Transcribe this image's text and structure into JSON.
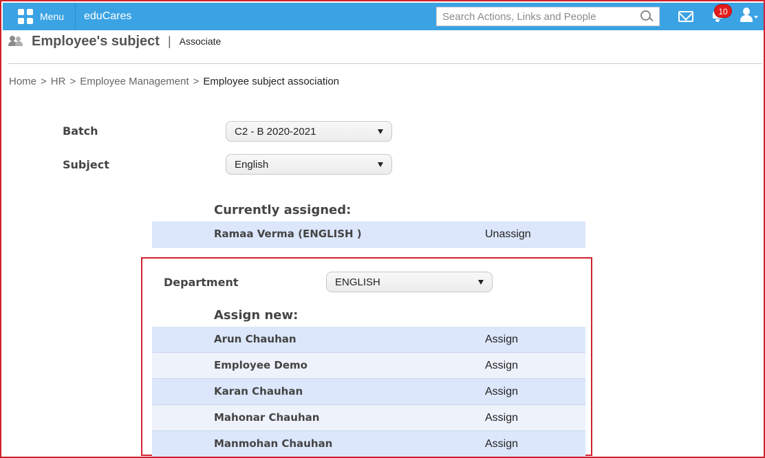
{
  "topbar": {
    "menu_label": "Menu",
    "brand": "eduCares",
    "search_placeholder": "Search Actions, Links and People",
    "notification_count": "10"
  },
  "header": {
    "title": "Employee's subject",
    "separator": "|",
    "subtitle": "Associate"
  },
  "breadcrumb": {
    "items": [
      "Home",
      "HR",
      "Employee Management"
    ],
    "current": "Employee subject association",
    "separator": ">"
  },
  "form": {
    "batch_label": "Batch",
    "batch_value": "C2 - B 2020-2021",
    "subject_label": "Subject",
    "subject_value": "English"
  },
  "current": {
    "title": "Currently assigned:",
    "rows": [
      {
        "name": "Ramaa Verma (ENGLISH )",
        "action": "Unassign"
      }
    ]
  },
  "assign": {
    "department_label": "Department",
    "department_value": "ENGLISH",
    "title": "Assign new:",
    "rows": [
      {
        "name": "Arun Chauhan",
        "action": "Assign"
      },
      {
        "name": "Employee Demo",
        "action": "Assign"
      },
      {
        "name": "Karan Chauhan",
        "action": "Assign"
      },
      {
        "name": "Mahonar Chauhan",
        "action": "Assign"
      },
      {
        "name": "Manmohan Chauhan",
        "action": "Assign"
      }
    ]
  },
  "colors": {
    "topbar": "#3ba3e4",
    "highlight_border": "#d0202e",
    "row_alt1": "#dce7fb",
    "row_alt2": "#eef2fb",
    "badge": "#e41b1b"
  }
}
